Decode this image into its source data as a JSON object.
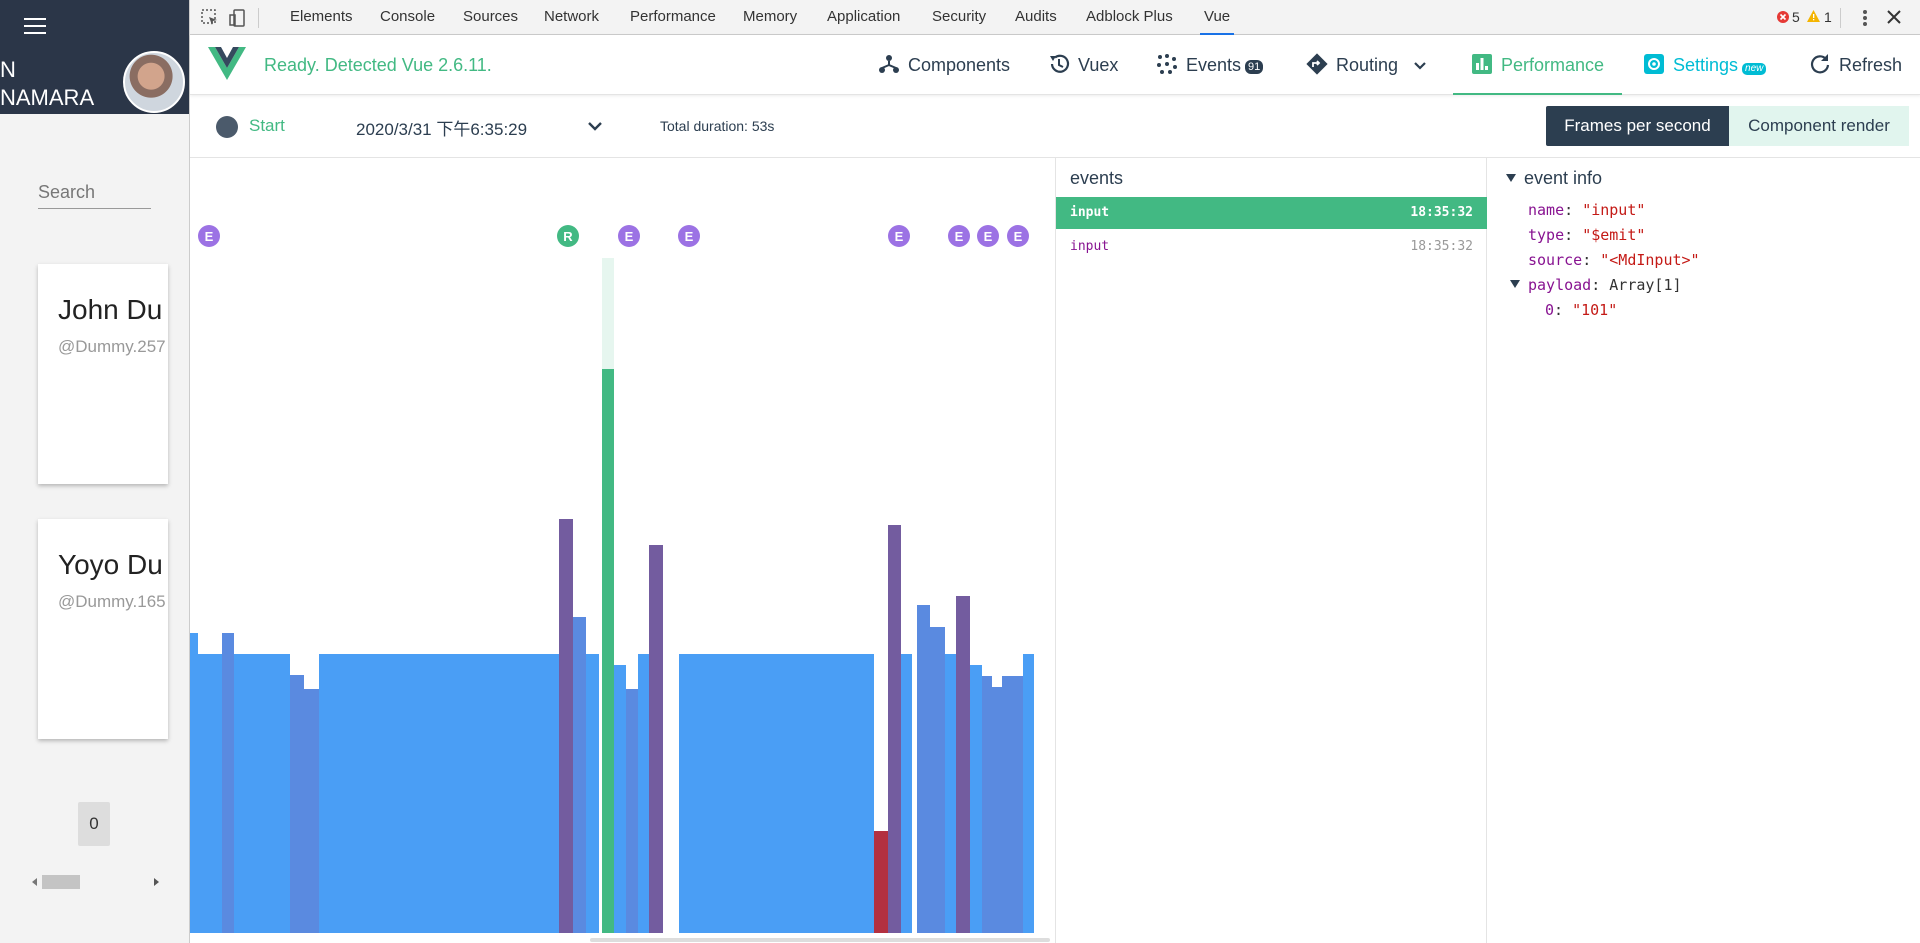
{
  "app": {
    "user_name": "N\nNAMARA",
    "search_placeholder": "Search",
    "cards": [
      {
        "name": "John Du",
        "handle": "@Dummy.257"
      },
      {
        "name": "Yoyo Du",
        "handle": "@Dummy.165"
      }
    ],
    "page_number": "0"
  },
  "devtools": {
    "tabs": [
      "Elements",
      "Console",
      "Sources",
      "Network",
      "Performance",
      "Memory",
      "Application",
      "Security",
      "Audits",
      "Adblock Plus",
      "Vue"
    ],
    "active_tab": "Vue",
    "error_count": "5",
    "warning_count": "1"
  },
  "vue": {
    "status": "Ready. Detected Vue 2.6.11.",
    "nav": {
      "components": "Components",
      "vuex": "Vuex",
      "events": "Events",
      "events_count": "91",
      "routing": "Routing",
      "performance": "Performance",
      "settings": "Settings",
      "settings_badge": "new",
      "refresh": "Refresh"
    },
    "active_nav": "Performance"
  },
  "toolbar": {
    "start": "Start",
    "date": "2020/3/31 下午6:35:29",
    "duration": "Total duration: 53s",
    "fps": "Frames per second",
    "component_render": "Component render"
  },
  "chart_data": {
    "type": "bar",
    "series_name": "fps",
    "markers": [
      "E",
      "R",
      "E",
      "E",
      "E",
      "E",
      "E",
      "E"
    ],
    "colors": {
      "primary": "#4a9ef5",
      "dim": "#5a8ae0",
      "purple": "#735c9f",
      "green": "#42b983",
      "red": "#b33040",
      "marker_e": "#9c72e4",
      "marker_r": "#42b983"
    }
  },
  "events_panel": {
    "title": "events",
    "rows": [
      {
        "name": "input",
        "time": "18:35:32",
        "selected": true
      },
      {
        "name": "input",
        "time": "18:35:32",
        "selected": false
      }
    ]
  },
  "event_info": {
    "title": "event info",
    "name_key": "name",
    "name_val": "\"input\"",
    "type_key": "type",
    "type_val": "\"$emit\"",
    "source_key": "source",
    "source_val": "\"<MdInput>\"",
    "payload_key": "payload",
    "payload_val": "Array[1]",
    "item_key": "0",
    "item_val": "\"101\""
  }
}
